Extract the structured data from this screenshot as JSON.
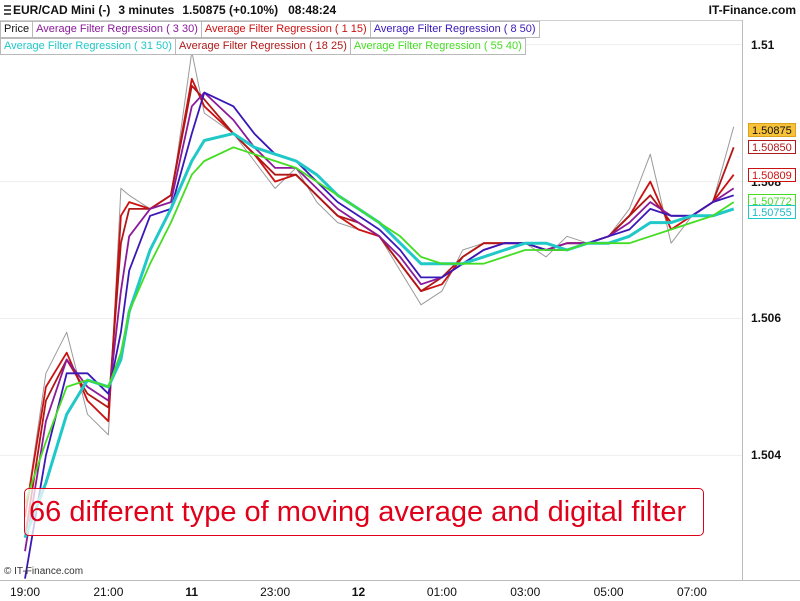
{
  "header": {
    "symbol": "EUR/CAD Mini (-)",
    "period": "3 minutes",
    "last_price_change": "1.50875 (+0.10%)",
    "time": "08:48:24",
    "brand": "IT-Finance.com"
  },
  "legend": {
    "row1": [
      {
        "label": "Price",
        "color": "#111111"
      },
      {
        "label": "Average Filter Regression ( 3 30)",
        "color": "#8B1A9A"
      },
      {
        "label": "Average Filter Regression ( 1 15)",
        "color": "#CC1111"
      },
      {
        "label": "Average Filter Regression ( 8 50)",
        "color": "#3A18B8"
      }
    ],
    "row2": [
      {
        "label": "Average Filter Regression ( 31 50)",
        "color": "#20C8C8"
      },
      {
        "label": "Average Filter Regression ( 18 25)",
        "color": "#B01818"
      },
      {
        "label": "Average Filter Regression ( 55 40)",
        "color": "#44DD22"
      }
    ]
  },
  "banner_text": "66 different type of moving average and digital filter",
  "watermark": "© IT-Finance.com",
  "price_labels": [
    {
      "text": "1.50875",
      "value": 1.50875,
      "bg": "#F7C23A",
      "fg": "#111111",
      "border": "#D9A21A"
    },
    {
      "text": "1.50850",
      "value": 1.5085,
      "bg": "#FFFFFF",
      "fg": "#B01818",
      "border": "#B01818"
    },
    {
      "text": "1.50809",
      "value": 1.50809,
      "bg": "#FFFFFF",
      "fg": "#CC1111",
      "border": "#CC1111"
    },
    {
      "text": "1.50772",
      "value": 1.50772,
      "bg": "#FFFFFF",
      "fg": "#44DD22",
      "border": "#44DD22"
    },
    {
      "text": "1.50755",
      "value": 1.50755,
      "bg": "#FFFFFF",
      "fg": "#20B8C8",
      "border": "#20C8C8"
    }
  ],
  "chart_data": {
    "type": "line",
    "y_ticks": [
      "1.51",
      "1.508",
      "1.506",
      "1.504"
    ],
    "y_tick_values": [
      1.51,
      1.508,
      1.506,
      1.504
    ],
    "ylim": [
      1.50218,
      1.51036
    ],
    "x_ticks": [
      {
        "label": "19:00",
        "bold": false
      },
      {
        "label": "21:00",
        "bold": false
      },
      {
        "label": "11",
        "bold": true
      },
      {
        "label": "23:00",
        "bold": false
      },
      {
        "label": "12",
        "bold": true
      },
      {
        "label": "01:00",
        "bold": false
      },
      {
        "label": "03:00",
        "bold": false
      },
      {
        "label": "05:00",
        "bold": false
      },
      {
        "label": "07:00",
        "bold": false
      }
    ],
    "x_tick_index": [
      0,
      1,
      2,
      3,
      4,
      5,
      6,
      7,
      8
    ],
    "x_index_range": [
      -0.3,
      8.6
    ],
    "series": [
      {
        "name": "Price",
        "color": "#9a9a9a",
        "x": [
          0,
          0.25,
          0.5,
          0.75,
          1.0,
          1.15,
          1.25,
          1.5,
          1.75,
          2.0,
          2.15,
          2.5,
          2.75,
          3.0,
          3.25,
          3.5,
          3.75,
          4.0,
          4.25,
          4.5,
          4.75,
          5.0,
          5.25,
          5.5,
          5.75,
          6.0,
          6.25,
          6.5,
          6.75,
          7.0,
          7.25,
          7.5,
          7.75,
          8.0,
          8.25,
          8.5
        ],
        "y": [
          1.5031,
          1.5052,
          1.5058,
          1.5046,
          1.5043,
          1.5079,
          1.5078,
          1.5076,
          1.5077,
          1.5099,
          1.509,
          1.5087,
          1.5083,
          1.5079,
          1.5082,
          1.5077,
          1.5074,
          1.5073,
          1.5072,
          1.5067,
          1.5062,
          1.5064,
          1.507,
          1.5071,
          1.5071,
          1.5071,
          1.5069,
          1.5072,
          1.5071,
          1.5072,
          1.5076,
          1.5084,
          1.5071,
          1.5075,
          1.5077,
          1.5088
        ]
      },
      {
        "name": "Average Filter Regression ( 1 15)",
        "color": "#CC1111",
        "x": [
          0,
          0.25,
          0.5,
          0.75,
          1.0,
          1.15,
          1.25,
          1.5,
          1.75,
          2.0,
          2.15,
          2.5,
          2.75,
          3.0,
          3.25,
          3.5,
          3.75,
          4.0,
          4.25,
          4.5,
          4.75,
          5.0,
          5.25,
          5.5,
          5.75,
          6.0,
          6.25,
          6.5,
          6.75,
          7.0,
          7.25,
          7.5,
          7.75,
          8.0,
          8.25,
          8.5
        ],
        "y": [
          1.5031,
          1.505,
          1.5055,
          1.5048,
          1.5045,
          1.5075,
          1.5077,
          1.5076,
          1.5078,
          1.5095,
          1.5091,
          1.5087,
          1.5084,
          1.508,
          1.5081,
          1.5078,
          1.5075,
          1.5073,
          1.5072,
          1.5068,
          1.5064,
          1.5065,
          1.5069,
          1.5071,
          1.5071,
          1.5071,
          1.507,
          1.5071,
          1.5071,
          1.5072,
          1.5075,
          1.508,
          1.5073,
          1.5075,
          1.5077,
          1.5081
        ]
      },
      {
        "name": "Average Filter Regression ( 18 25)",
        "color": "#B01818",
        "x": [
          0,
          0.25,
          0.5,
          0.75,
          1.0,
          1.15,
          1.25,
          1.5,
          1.75,
          2.0,
          2.15,
          2.5,
          2.75,
          3.0,
          3.25,
          3.5,
          3.75,
          4.0,
          4.25,
          4.5,
          4.75,
          5.0,
          5.25,
          5.5,
          5.75,
          6.0,
          6.25,
          6.5,
          6.75,
          7.0,
          7.25,
          7.5,
          7.75,
          8.0,
          8.25,
          8.5
        ],
        "y": [
          1.5028,
          1.5048,
          1.5054,
          1.5049,
          1.5047,
          1.5071,
          1.5076,
          1.5076,
          1.5078,
          1.5094,
          1.5092,
          1.5087,
          1.5084,
          1.5081,
          1.5081,
          1.5078,
          1.5075,
          1.5074,
          1.5072,
          1.5068,
          1.5064,
          1.5066,
          1.5069,
          1.5071,
          1.5071,
          1.5071,
          1.507,
          1.5071,
          1.5071,
          1.5072,
          1.5075,
          1.5078,
          1.5074,
          1.5075,
          1.5077,
          1.5085
        ]
      },
      {
        "name": "Average Filter Regression ( 3 30)",
        "color": "#8B1A9A",
        "x": [
          0,
          0.25,
          0.5,
          0.75,
          1.0,
          1.15,
          1.25,
          1.5,
          1.75,
          2.0,
          2.15,
          2.5,
          2.75,
          3.0,
          3.25,
          3.5,
          3.75,
          4.0,
          4.25,
          4.5,
          4.75,
          5.0,
          5.25,
          5.5,
          5.75,
          6.0,
          6.25,
          6.5,
          6.75,
          7.0,
          7.25,
          7.5,
          7.75,
          8.0,
          8.25,
          8.5
        ],
        "y": [
          1.5026,
          1.5045,
          1.5054,
          1.505,
          1.5048,
          1.5064,
          1.5072,
          1.5076,
          1.5077,
          1.5091,
          1.5093,
          1.5089,
          1.5085,
          1.5082,
          1.5082,
          1.5079,
          1.5076,
          1.5074,
          1.5072,
          1.5069,
          1.5065,
          1.5066,
          1.5068,
          1.507,
          1.5071,
          1.5071,
          1.507,
          1.5071,
          1.5071,
          1.5072,
          1.5074,
          1.5077,
          1.5075,
          1.5075,
          1.5077,
          1.5079
        ]
      },
      {
        "name": "Average Filter Regression ( 8 50)",
        "color": "#3A18B8",
        "x": [
          0,
          0.25,
          0.5,
          0.75,
          1.0,
          1.15,
          1.25,
          1.5,
          1.75,
          2.0,
          2.15,
          2.5,
          2.75,
          3.0,
          3.25,
          3.5,
          3.75,
          4.0,
          4.25,
          4.5,
          4.75,
          5.0,
          5.25,
          5.5,
          5.75,
          6.0,
          6.25,
          6.5,
          6.75,
          7.0,
          7.25,
          7.5,
          7.75,
          8.0,
          8.25,
          8.5
        ],
        "y": [
          1.5022,
          1.504,
          1.5052,
          1.5052,
          1.5049,
          1.5058,
          1.5067,
          1.5075,
          1.5076,
          1.5087,
          1.5093,
          1.5091,
          1.5087,
          1.5084,
          1.5083,
          1.508,
          1.5077,
          1.5075,
          1.5073,
          1.507,
          1.5066,
          1.5066,
          1.5068,
          1.507,
          1.5071,
          1.5071,
          1.507,
          1.507,
          1.5071,
          1.5072,
          1.5073,
          1.5076,
          1.5075,
          1.5075,
          1.5077,
          1.5078
        ]
      },
      {
        "name": "Average Filter Regression ( 31 50)",
        "color": "#20C8C8",
        "x": [
          0,
          0.25,
          0.5,
          0.75,
          1.0,
          1.15,
          1.25,
          1.5,
          1.75,
          2.0,
          2.15,
          2.5,
          2.75,
          3.0,
          3.25,
          3.5,
          3.75,
          4.0,
          4.25,
          4.5,
          4.75,
          5.0,
          5.25,
          5.5,
          5.75,
          6.0,
          6.25,
          6.5,
          6.75,
          7.0,
          7.25,
          7.5,
          7.75,
          8.0,
          8.25,
          8.5
        ],
        "y": [
          1.5028,
          1.5036,
          1.5046,
          1.5051,
          1.505,
          1.5054,
          1.5061,
          1.507,
          1.5076,
          1.5083,
          1.5086,
          1.5087,
          1.5085,
          1.5084,
          1.5083,
          1.5081,
          1.5078,
          1.5076,
          1.5074,
          1.5071,
          1.5068,
          1.5068,
          1.5068,
          1.5069,
          1.507,
          1.5071,
          1.5071,
          1.507,
          1.5071,
          1.5071,
          1.5072,
          1.5074,
          1.5074,
          1.5075,
          1.5075,
          1.5076
        ]
      },
      {
        "name": "Average Filter Regression ( 55 40)",
        "color": "#44DD22",
        "x": [
          0,
          0.25,
          0.5,
          0.75,
          1.0,
          1.15,
          1.25,
          1.5,
          1.75,
          2.0,
          2.15,
          2.5,
          2.75,
          3.0,
          3.25,
          3.5,
          3.75,
          4.0,
          4.25,
          4.5,
          4.75,
          5.0,
          5.25,
          5.5,
          5.75,
          6.0,
          6.25,
          6.5,
          6.75,
          7.0,
          7.25,
          7.5,
          7.75,
          8.0,
          8.25,
          8.5
        ],
        "y": [
          1.5033,
          1.5042,
          1.505,
          1.5051,
          1.505,
          1.5055,
          1.5061,
          1.5068,
          1.5074,
          1.5081,
          1.5083,
          1.5085,
          1.5084,
          1.5083,
          1.5082,
          1.508,
          1.5078,
          1.5076,
          1.5074,
          1.5072,
          1.5069,
          1.5068,
          1.5068,
          1.5068,
          1.5069,
          1.507,
          1.507,
          1.507,
          1.5071,
          1.5071,
          1.5071,
          1.5072,
          1.5073,
          1.5074,
          1.5075,
          1.5077
        ]
      }
    ]
  }
}
